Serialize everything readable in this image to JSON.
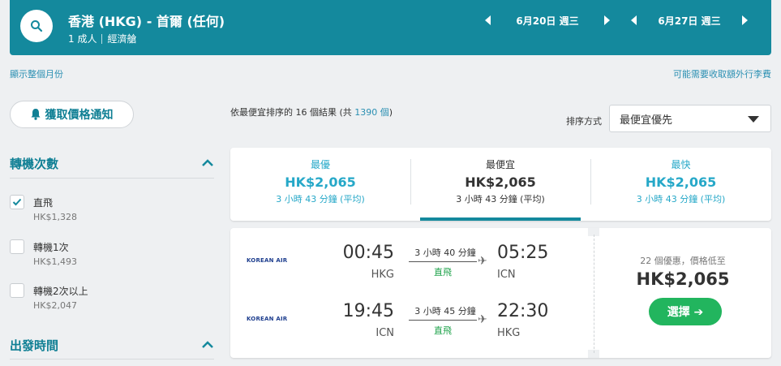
{
  "header": {
    "route": "香港 (HKG) - 首爾 (任何)",
    "passengers": "1 成人",
    "cabin": "經濟艙",
    "depart_date": "6月20日 週三",
    "return_date": "6月27日 週三"
  },
  "links": {
    "show_month": "顯示整個月份",
    "extra_fees": "可能需要收取額外行李費"
  },
  "sidebar": {
    "price_alert_label": "獲取價格通知",
    "stops_title": "轉機次數",
    "stops": [
      {
        "label": "直飛",
        "price": "HK$1,328",
        "checked": true
      },
      {
        "label": "轉機1次",
        "price": "HK$1,493",
        "checked": false
      },
      {
        "label": "轉機2次以上",
        "price": "HK$2,047",
        "checked": false
      }
    ],
    "depart_time_title": "出發時間"
  },
  "results": {
    "prefix": "依最便宜排序的 16 個結果 (共 ",
    "total": "1390 個",
    "suffix": ")"
  },
  "sort": {
    "label": "排序方式",
    "selected": "最便宜優先"
  },
  "tabs": [
    {
      "name": "最優",
      "price": "HK$2,065",
      "duration": "3 小時 43 分鐘 (平均)"
    },
    {
      "name": "最便宜",
      "price": "HK$2,065",
      "duration": "3 小時 43 分鐘 (平均)"
    },
    {
      "name": "最快",
      "price": "HK$2,065",
      "duration": "3 小時 43 分鐘 (平均)"
    }
  ],
  "flight": {
    "legs": [
      {
        "airline": "KOREAN AIR",
        "depart_time": "00:45",
        "depart_code": "HKG",
        "duration": "3 小時 40 分鐘",
        "stops": "直飛",
        "arrive_time": "05:25",
        "arrive_code": "ICN"
      },
      {
        "airline": "KOREAN AIR",
        "depart_time": "19:45",
        "depart_code": "ICN",
        "duration": "3 小時 45 分鐘",
        "stops": "直飛",
        "arrive_time": "22:30",
        "arrive_code": "HKG"
      }
    ],
    "offers": "22 個優惠，價格低至",
    "price": "HK$2,065",
    "select_label": "選擇 ➔"
  },
  "icons": {
    "search": "search-icon",
    "bell": "bell-icon",
    "prev": "chevron-left-icon",
    "next": "chevron-right-icon",
    "collapse": "chevron-up-icon",
    "plane": "airplane-icon",
    "check": "check-icon"
  },
  "colors": {
    "header_bg": "#14899d",
    "accent": "#26a8c8",
    "select_button": "#22b55e",
    "direct": "#1ea24a"
  }
}
